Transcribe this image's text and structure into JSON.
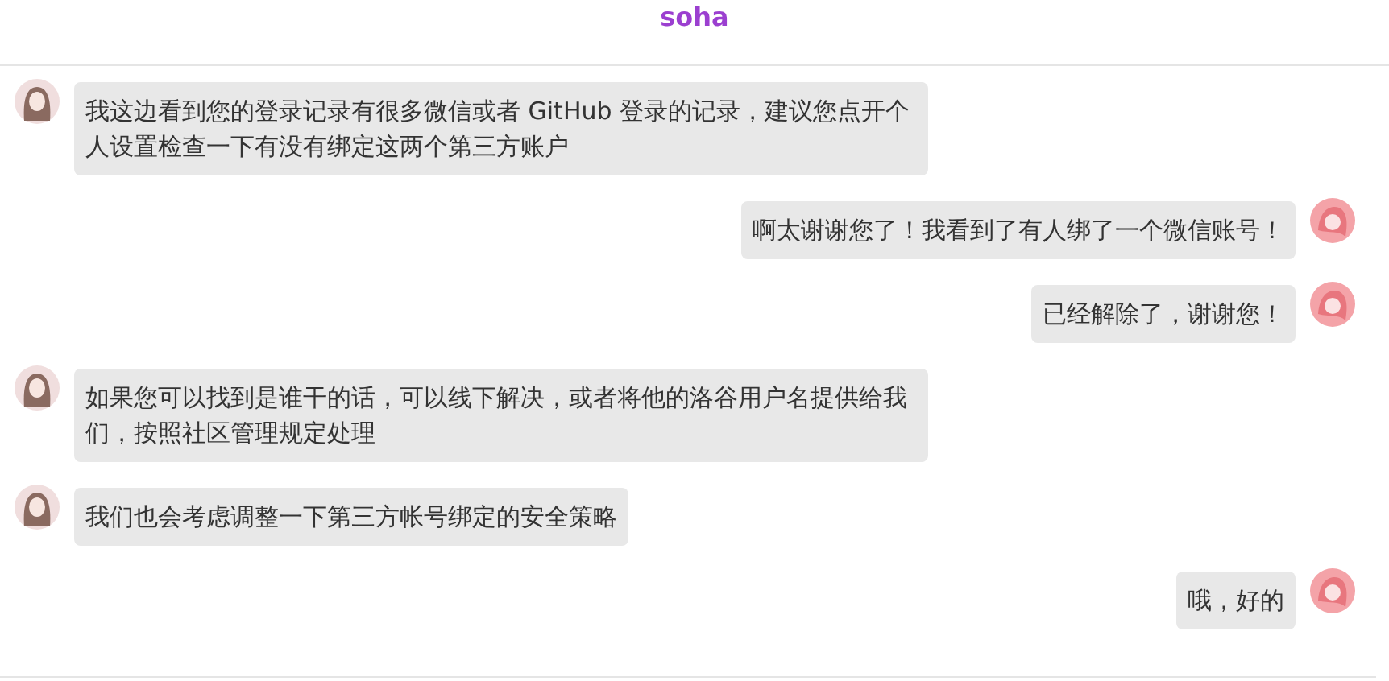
{
  "header": {
    "title": "soha"
  },
  "messages": [
    {
      "kind": "received",
      "text": "我这边看到您的登录记录有很多微信或者 GitHub 登录的记录，建议您点开个人设置检查一下有没有绑定这两个第三方账户"
    },
    {
      "kind": "sent",
      "text": "啊太谢谢您了！我看到了有人绑了一个微信账号！"
    },
    {
      "kind": "sent",
      "text": "已经解除了，谢谢您！"
    },
    {
      "kind": "received",
      "text": "如果您可以找到是谁干的话，可以线下解决，或者将他的洛谷用户名提供给我们，按照社区管理规定处理"
    },
    {
      "kind": "received",
      "text": "我们也会考虑调整一下第三方帐号绑定的安全策略"
    },
    {
      "kind": "sent",
      "text": "哦，好的"
    }
  ]
}
